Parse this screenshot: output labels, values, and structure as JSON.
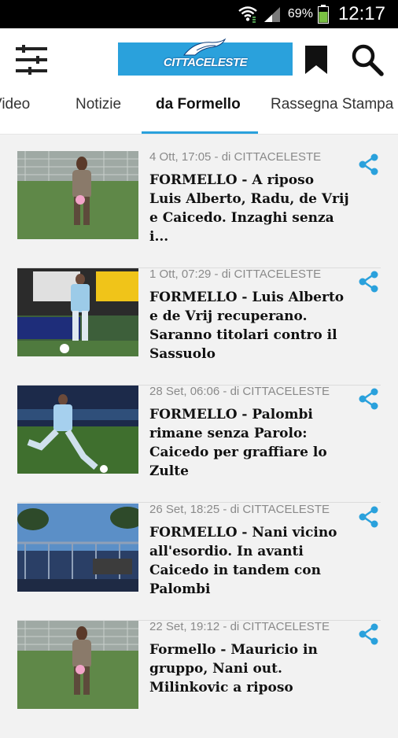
{
  "status_bar": {
    "battery_percent": "69%",
    "time": "12:17"
  },
  "app_bar": {
    "logo_text": "CITTACELESTE"
  },
  "tabs": [
    {
      "label": "Video",
      "active": false
    },
    {
      "label": "Notizie",
      "active": false
    },
    {
      "label": "da Formello",
      "active": true
    },
    {
      "label": "Rassegna Stampa",
      "active": false
    }
  ],
  "articles": [
    {
      "meta": "4 Ott, 17:05 - di CITTACELESTE",
      "title": "FORMELLO - A riposo Luis Alberto, Radu, de Vrij e Caicedo. Inzaghi senza i...",
      "thumb": "training-pitch"
    },
    {
      "meta": "1 Ott, 07:29 - di CITTACELESTE",
      "title": "FORMELLO - Luis Alberto e de Vrij recuperano. Saranno titolari contro il Sassuolo",
      "thumb": "match-action-banner"
    },
    {
      "meta": "28 Set, 06:06 - di CITTACELESTE",
      "title": "FORMELLO - Palombi rimane senza Parolo: Caicedo per graffiare lo Zulte",
      "thumb": "player-kicking"
    },
    {
      "meta": "26 Set, 18:25 - di CITTACELESTE",
      "title": "FORMELLO - Nani vicino all'esordio. In avanti Caicedo in tandem con Palombi",
      "thumb": "training-gate"
    },
    {
      "meta": "22 Set, 19:12 - di CITTACELESTE",
      "title": "Formello - Mauricio in gruppo, Nani out. Milinkovic a riposo",
      "thumb": "training-pitch"
    }
  ],
  "colors": {
    "accent": "#2aa1dc",
    "share_icon": "#2aa1dc",
    "meta_text": "#8a8a8a"
  }
}
